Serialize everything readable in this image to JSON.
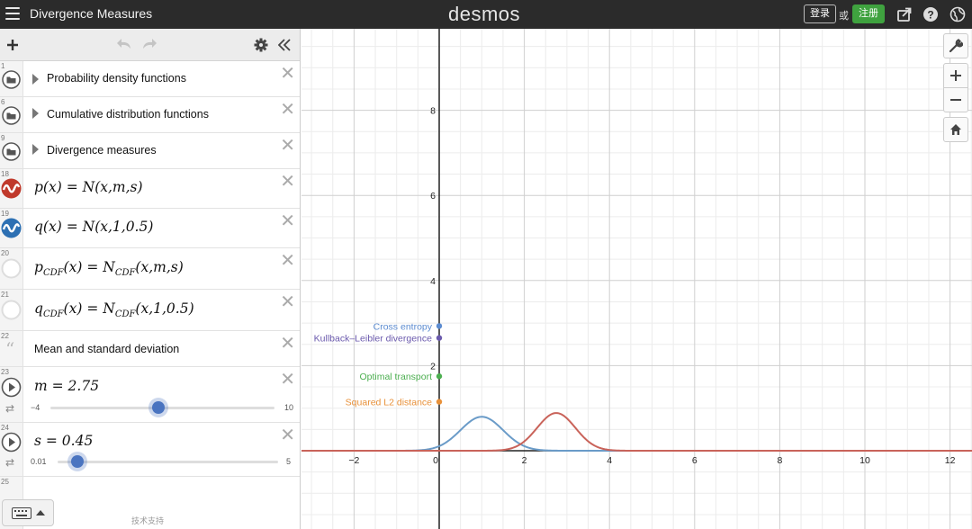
{
  "header": {
    "title": "Divergence Measures",
    "logo": "desmos",
    "login_label": "登录",
    "or_label": "或",
    "signup_label": "注册",
    "icons": [
      "share-icon",
      "help-icon",
      "globe-icon"
    ]
  },
  "expressions": {
    "items": [
      {
        "num": "1",
        "type": "folder",
        "label": "Probability density functions"
      },
      {
        "num": "6",
        "type": "folder",
        "label": "Cumulative distribution functions"
      },
      {
        "num": "9",
        "type": "folder",
        "label": "Divergence measures"
      },
      {
        "num": "18",
        "type": "expr",
        "color": "#c0392b"
      },
      {
        "num": "19",
        "type": "expr",
        "color": "#2d70b3"
      },
      {
        "num": "20",
        "type": "expr"
      },
      {
        "num": "21",
        "type": "expr"
      },
      {
        "num": "22",
        "type": "note",
        "label": "Mean and standard deviation"
      },
      {
        "num": "23",
        "type": "slider",
        "min": "−4",
        "max": "10",
        "value": 2.75
      },
      {
        "num": "24",
        "type": "slider",
        "min": "0.01",
        "max": "5",
        "value": 0.45
      },
      {
        "num": "25",
        "type": "empty"
      }
    ],
    "math": {
      "p": {
        "lhs": "p(x)",
        "rhs": "N(x,m,s)"
      },
      "q": {
        "lhs": "q(x)",
        "rhs": "N(x,1,0.5)"
      },
      "pcdf": {
        "lhs_var": "p",
        "lhs_sub": "CDF",
        "lhs_arg": "(x)",
        "rhs_fn": "N",
        "rhs_sub": "CDF",
        "rhs_arg": "(x,m,s)"
      },
      "qcdf": {
        "lhs_var": "q",
        "lhs_sub": "CDF",
        "lhs_arg": "(x)",
        "rhs_fn": "N",
        "rhs_sub": "CDF",
        "rhs_arg": "(x,1,0.5)"
      },
      "m": {
        "text": "m = 2.75"
      },
      "s": {
        "text": "s = 0.45"
      }
    },
    "footer_text": "技术支持"
  },
  "graph": {
    "x_ticks": [
      "−2",
      "0",
      "2",
      "4",
      "6",
      "8",
      "10",
      "12"
    ],
    "y_ticks": [
      "2",
      "4",
      "6",
      "8"
    ],
    "points": [
      {
        "label": "Cross entropy",
        "color": "#5b8bd0",
        "y": 2.93
      },
      {
        "label": "Kullback–Leibler divergence",
        "color": "#6b5aad",
        "y": 2.65
      },
      {
        "label": "Optimal transport",
        "color": "#4caf50",
        "y": 1.75
      },
      {
        "label": "Squared L2 distance",
        "color": "#e8913a",
        "y": 1.15
      }
    ],
    "curves": [
      {
        "name": "q",
        "color": "#6a9bc8",
        "mean": 1,
        "sd": 0.5
      },
      {
        "name": "p",
        "color": "#c9635a",
        "mean": 2.75,
        "sd": 0.45
      }
    ]
  },
  "tools": [
    "wrench-icon",
    "zoom-in-icon",
    "zoom-out-icon",
    "home-icon"
  ]
}
